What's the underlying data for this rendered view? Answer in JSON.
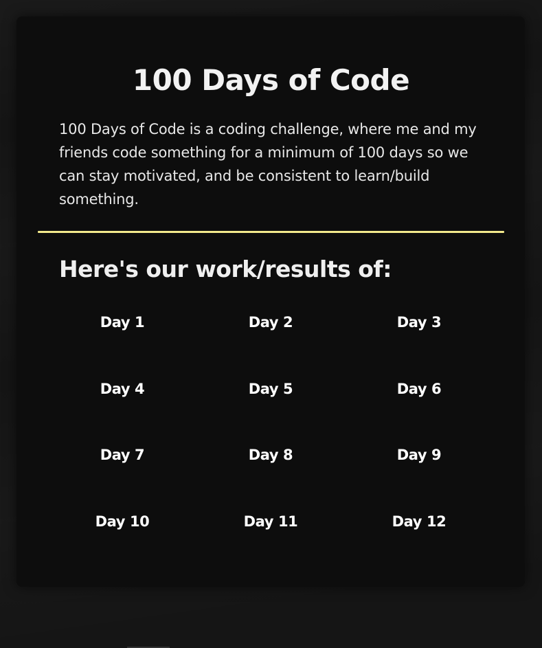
{
  "page": {
    "title": "100 Days of Code",
    "intro": "100 Days of Code is a coding challenge, where me and my friends code something for a minimum of 100 days so we can stay motivated, and be consistent to learn/build something.",
    "subtitle": "Here's our work/results of:",
    "divider_color": "#f3e98c"
  },
  "days": [
    {
      "label": "Day 1"
    },
    {
      "label": "Day 2"
    },
    {
      "label": "Day 3"
    },
    {
      "label": "Day 4"
    },
    {
      "label": "Day 5"
    },
    {
      "label": "Day 6"
    },
    {
      "label": "Day 7"
    },
    {
      "label": "Day 8"
    },
    {
      "label": "Day 9"
    },
    {
      "label": "Day 10"
    },
    {
      "label": "Day 11"
    },
    {
      "label": "Day 12"
    }
  ]
}
